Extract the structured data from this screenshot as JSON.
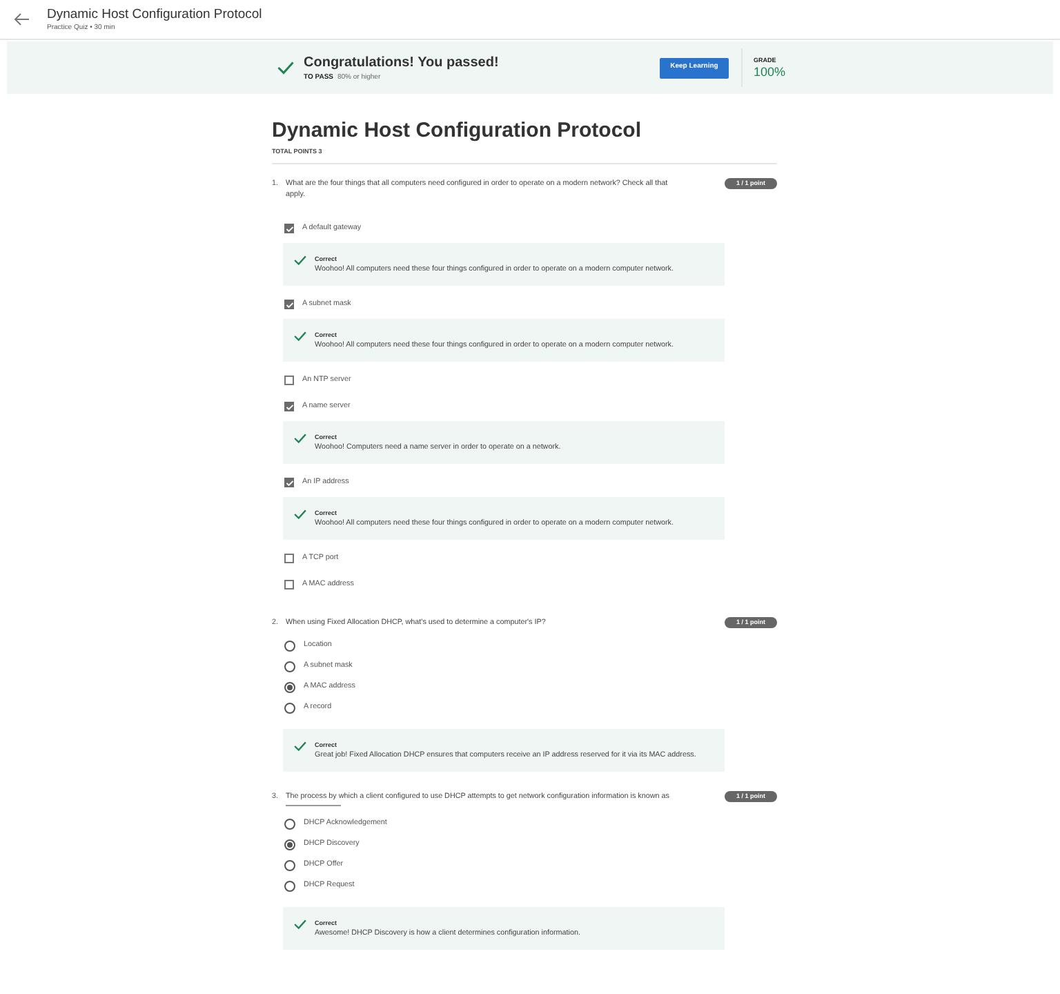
{
  "header": {
    "title": "Dynamic Host Configuration Protocol",
    "subtitle": "Practice Quiz • 30 min"
  },
  "banner": {
    "message": "Congratulations! You passed!",
    "pass_label": "TO PASS",
    "pass_value": "80% or higher",
    "button": "Keep Learning",
    "grade_label": "GRADE",
    "grade_value": "100%"
  },
  "quiz": {
    "title": "Dynamic Host Configuration Protocol",
    "total_points": "TOTAL POINTS 3"
  },
  "questions": [
    {
      "number": "1.",
      "text": "What are the four things that all computers need configured in order to operate on a modern network? Check all that apply.",
      "points": "1 / 1 point",
      "kind": "checkbox",
      "options": [
        {
          "label": "A default gateway",
          "selected": true,
          "feedback": {
            "title": "Correct",
            "text": "Woohoo! All computers need these four things configured in order to operate on a modern computer network."
          }
        },
        {
          "label": "A subnet mask",
          "selected": true,
          "feedback": {
            "title": "Correct",
            "text": "Woohoo! All computers need these four things configured in order to operate on a modern computer network."
          }
        },
        {
          "label": "An NTP server",
          "selected": false
        },
        {
          "label": "A name server",
          "selected": true,
          "feedback": {
            "title": "Correct",
            "text": "Woohoo! Computers need a name server in order to operate on a network."
          }
        },
        {
          "label": "An IP address",
          "selected": true,
          "feedback": {
            "title": "Correct",
            "text": "Woohoo! All computers need these four things configured in order to operate on a modern computer network."
          }
        },
        {
          "label": "A TCP port",
          "selected": false
        },
        {
          "label": "A MAC address",
          "selected": false
        }
      ]
    },
    {
      "number": "2.",
      "text": "When using Fixed Allocation DHCP, what's used to determine a computer's IP?",
      "points": "1 / 1 point",
      "kind": "radio",
      "options": [
        {
          "label": "Location",
          "selected": false
        },
        {
          "label": "A subnet mask",
          "selected": false
        },
        {
          "label": "A MAC address",
          "selected": true
        },
        {
          "label": "A record",
          "selected": false
        }
      ],
      "feedback": {
        "title": "Correct",
        "text": "Great job! Fixed Allocation DHCP ensures that computers receive an IP address reserved for it via its MAC address."
      }
    },
    {
      "number": "3.",
      "text": "The process by which a client configured to use DHCP attempts to get network configuration information is known as",
      "points": "1 / 1 point",
      "kind": "radio",
      "blank": true,
      "options": [
        {
          "label": "DHCP Acknowledgement",
          "selected": false
        },
        {
          "label": "DHCP Discovery",
          "selected": true
        },
        {
          "label": "DHCP Offer",
          "selected": false
        },
        {
          "label": "DHCP Request",
          "selected": false
        }
      ],
      "feedback": {
        "title": "Correct",
        "text": "Awesome! DHCP Discovery is how a client determines configuration information."
      }
    }
  ]
}
